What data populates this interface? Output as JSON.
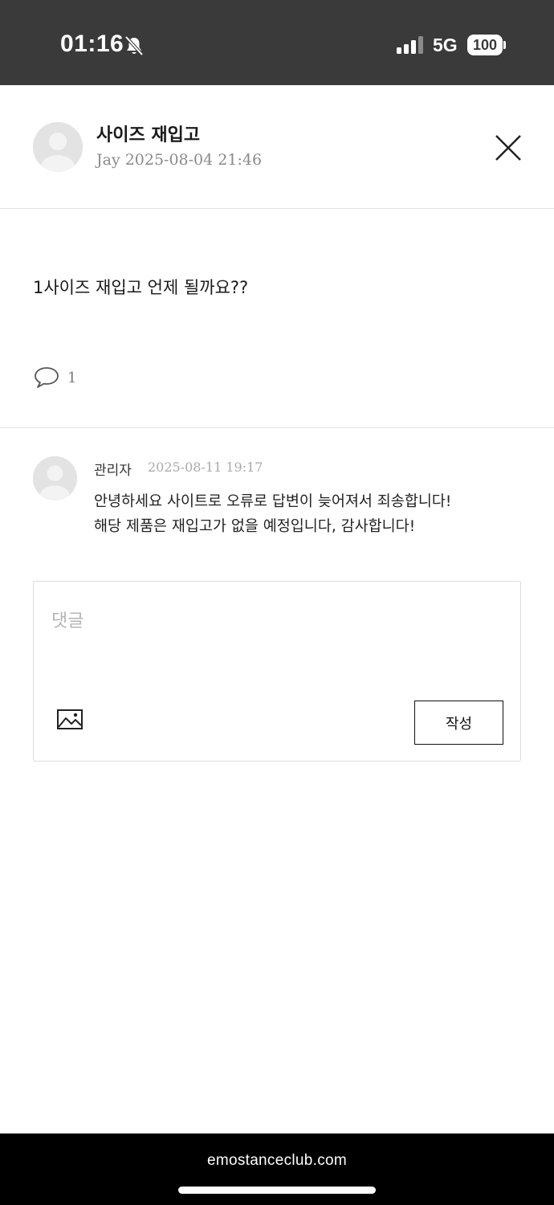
{
  "status_bar": {
    "time": "01:16",
    "network": "5G",
    "battery": "100"
  },
  "post": {
    "title": "사이즈 재입고",
    "author": "Jay",
    "date": "2025-08-04 21:46",
    "body": "1사이즈 재입고 언제 될까요??",
    "comment_count": "1"
  },
  "comments": [
    {
      "author": "관리자",
      "date": "2025-08-11 19:17",
      "lines": [
        "안녕하세요 사이트로 오류로 답변이 늦어져서 죄송합니다!",
        "해당 제품은 재입고가 없을 예정입니다, 감사합니다!"
      ]
    }
  ],
  "comment_form": {
    "placeholder": "댓글",
    "submit_label": "작성"
  },
  "browser": {
    "url": "emostanceclub.com"
  },
  "colors": {
    "status_bar_bg": "#3a3a3a",
    "avatar_bg": "#e3e3e3",
    "bottom_bar_bg": "#000000"
  }
}
